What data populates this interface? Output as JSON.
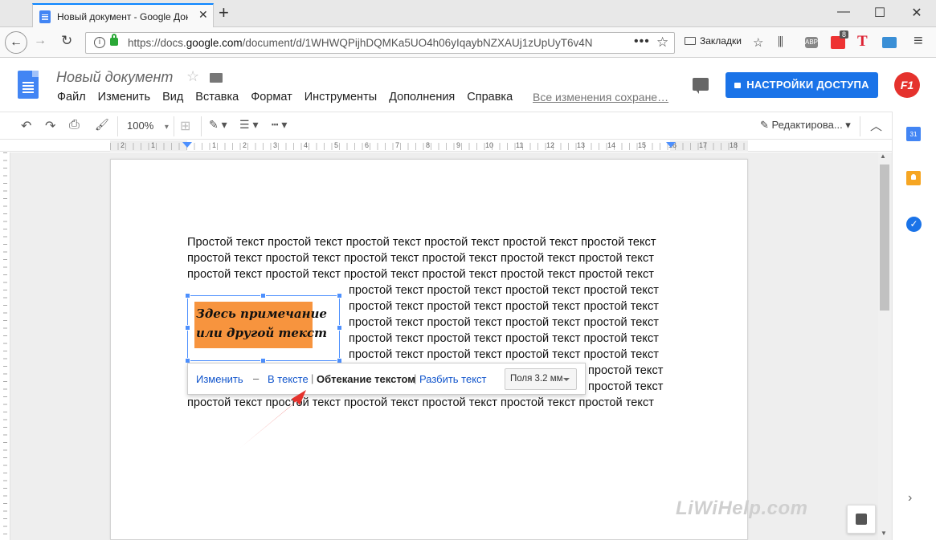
{
  "browser": {
    "tab_title": "Новый документ - Google Доку",
    "tab_close": "✕",
    "new_tab": "+",
    "window_controls": {
      "minimize": "—",
      "maximize": "☐",
      "close": "✕"
    },
    "nav": {
      "back": "←",
      "forward": "→",
      "reload": "↻"
    },
    "url_prefix": "https://docs.",
    "url_domain": "google.com",
    "url_rest": "/document/d/1WHWQPijhDQMKa5UO4h06yIqaybNZXAUj1zUpUyT6v4N",
    "url_more": "•••",
    "url_star": "☆",
    "bookmarks_label": "Закладки",
    "toolbar_badge": "8",
    "toolbar_t": "T",
    "abp": "ABP",
    "menu_icon": "≡"
  },
  "docs": {
    "title": "Новый документ",
    "star": "☆",
    "menu": [
      "Файл",
      "Изменить",
      "Вид",
      "Вставка",
      "Формат",
      "Инструменты",
      "Дополнения",
      "Справка"
    ],
    "saved_status": "Все изменения сохране…",
    "share_button": "НАСТРОЙКИ ДОСТУПА",
    "avatar_label": "F1",
    "accent_color": "#1a73e8"
  },
  "toolbar": {
    "undo": "↶",
    "redo": "↷",
    "print": "⎙",
    "paint": "🖌",
    "zoom": "100%",
    "zoom_caret": "▾",
    "add": "⊞",
    "pen": "✎ ▾",
    "line": "☰ ▾",
    "dash": "┅ ▾",
    "editing_mode": "✎  Редактирова... ▾",
    "collapse": "︿"
  },
  "ruler": {
    "numbers": "2 · 1 · · · 1 · 2 · 3 · 4 · 5 · 6 · 7 · 8 · 9 · 10 · 11 · 12 · 13 · 14 · 15 · 16 · 17 · 18"
  },
  "document": {
    "lines_full_top": [
      "Простой текст простой текст простой текст простой текст простой текст простой текст",
      "простой текст простой текст простой текст простой текст простой текст простой текст",
      "простой текст простой текст простой текст простой текст простой текст простой текст"
    ],
    "lines_wrapped": [
      "простой текст простой текст простой текст простой текст",
      "простой текст простой текст простой текст простой текст",
      "простой текст простой текст простой текст простой текст",
      "простой текст простой текст простой текст простой текст",
      "простой текст простой текст простой текст простой текст",
      "простой текст",
      "простой текст"
    ],
    "line_last": "простой текст простой текст простой текст простой текст простой текст простой текст",
    "image_text_1": "Здесь примечание",
    "image_text_2": "или другой  текст",
    "image_bg": "#f7943e"
  },
  "image_toolbar": {
    "edit": "Изменить",
    "dash": "–",
    "inline": "В тексте",
    "sep1": "|",
    "wrap": "Обтекание текстом",
    "sep2": "|",
    "break": "Разбить текст",
    "margin": "Поля 3.2 мм"
  },
  "watermark": "LiWiHelp.com",
  "side_panel": {
    "calendar": "31",
    "tasks": "✓",
    "expand": "›"
  },
  "scroll": {
    "up": "▲",
    "down": "▼"
  }
}
